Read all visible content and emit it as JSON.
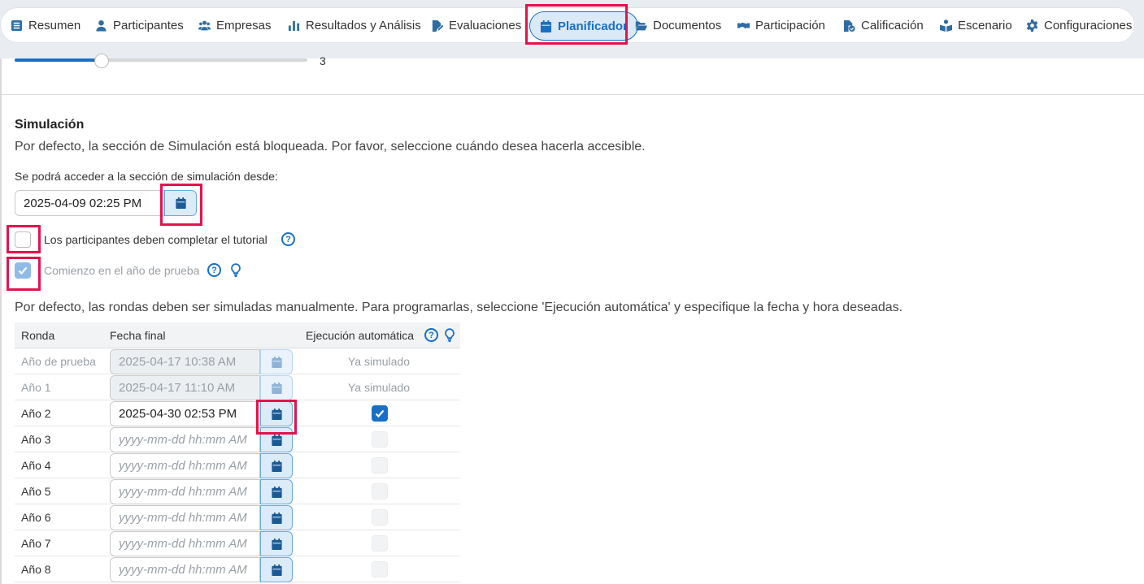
{
  "nav": {
    "items": [
      {
        "label": "Resumen",
        "icon": "list-icon"
      },
      {
        "label": "Participantes",
        "icon": "user-icon"
      },
      {
        "label": "Empresas",
        "icon": "users-icon"
      },
      {
        "label": "Resultados y Análisis",
        "icon": "bar-chart-icon"
      },
      {
        "label": "Evaluaciones",
        "icon": "file-edit-icon"
      },
      {
        "label": "Planificador",
        "icon": "calendar-icon",
        "active": true
      },
      {
        "label": "Documentos",
        "icon": "folder-open-icon"
      },
      {
        "label": "Participación",
        "icon": "handshake-icon"
      },
      {
        "label": "Calificación",
        "icon": "file-check-icon"
      },
      {
        "label": "Escenario",
        "icon": "book-reader-icon"
      },
      {
        "label": "Configuraciones",
        "icon": "gear-icon"
      }
    ]
  },
  "slider": {
    "value": "3"
  },
  "simulation": {
    "title": "Simulación",
    "description": "Por defecto, la sección de Simulación está bloqueada. Por favor, seleccione cuándo desea hacerla accesible.",
    "access_label": "Se podrá acceder a la sección de simulación desde:",
    "access_datetime": "2025-04-09 02:25 PM",
    "tutorial_label": "Los participantes deben completar el tutorial",
    "tutorial_checked": false,
    "trial_label": "Comienzo en el año de prueba",
    "trial_checked": true
  },
  "rounds": {
    "description": "Por defecto, las rondas deben ser simuladas manualmente. Para programarlas, seleccione 'Ejecución automática' y especifique la fecha y hora deseadas.",
    "headers": {
      "round": "Ronda",
      "end_date": "Fecha final",
      "auto": "Ejecución automática"
    },
    "placeholder": "yyyy-mm-dd hh:mm AM",
    "rows": [
      {
        "name": "Año de prueba",
        "date": "2025-04-17 10:38 AM",
        "status": "Ya simulado",
        "state": "done"
      },
      {
        "name": "Año 1",
        "date": "2025-04-17 11:10 AM",
        "status": "Ya simulado",
        "state": "done"
      },
      {
        "name": "Año 2",
        "date": "2025-04-30 02:53 PM",
        "status": "",
        "state": "scheduled"
      },
      {
        "name": "Año 3",
        "date": "",
        "status": "",
        "state": "empty"
      },
      {
        "name": "Año 4",
        "date": "",
        "status": "",
        "state": "empty"
      },
      {
        "name": "Año 5",
        "date": "",
        "status": "",
        "state": "empty"
      },
      {
        "name": "Año 6",
        "date": "",
        "status": "",
        "state": "empty"
      },
      {
        "name": "Año 7",
        "date": "",
        "status": "",
        "state": "empty"
      },
      {
        "name": "Año 8",
        "date": "",
        "status": "",
        "state": "empty"
      }
    ]
  },
  "colors": {
    "accent": "#1a6fc4",
    "highlight": "#e2134d"
  }
}
